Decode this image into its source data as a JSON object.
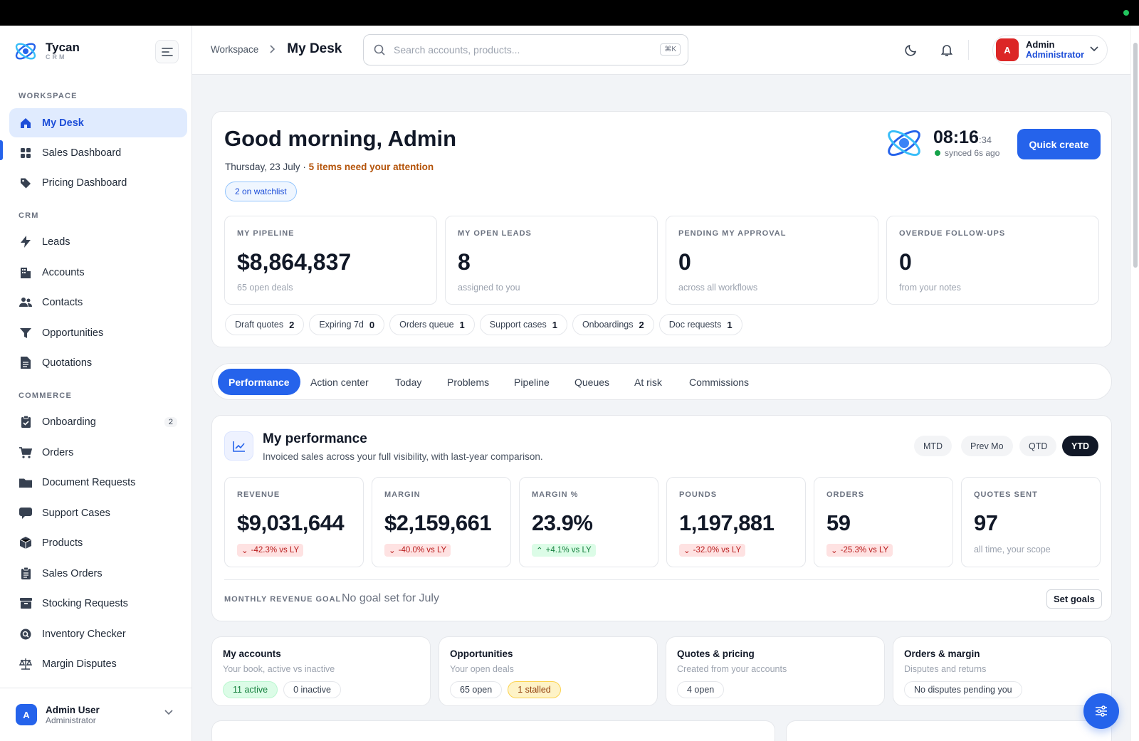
{
  "brand": {
    "name": "Tycan",
    "sub": "CRM"
  },
  "sidebar": {
    "sections": [
      "WORKSPACE",
      "CRM",
      "COMMERCE"
    ],
    "workspace": [
      {
        "label": "My Desk",
        "icon": "home-icon"
      },
      {
        "label": "Sales Dashboard",
        "icon": "grid-icon"
      },
      {
        "label": "Pricing Dashboard",
        "icon": "tag-icon"
      }
    ],
    "crm": [
      {
        "label": "Leads",
        "icon": "bolt-icon"
      },
      {
        "label": "Accounts",
        "icon": "building-icon"
      },
      {
        "label": "Contacts",
        "icon": "users-icon"
      },
      {
        "label": "Opportunities",
        "icon": "funnel-icon"
      },
      {
        "label": "Quotations",
        "icon": "document-icon"
      }
    ],
    "commerce": [
      {
        "label": "Onboarding",
        "icon": "clipboard-icon",
        "badge": "2"
      },
      {
        "label": "Orders",
        "icon": "cart-icon"
      },
      {
        "label": "Document Requests",
        "icon": "folder-icon"
      },
      {
        "label": "Support Cases",
        "icon": "chat-icon"
      },
      {
        "label": "Products",
        "icon": "cube-icon"
      },
      {
        "label": "Sales Orders",
        "icon": "receipt-icon"
      },
      {
        "label": "Stocking Requests",
        "icon": "archive-icon"
      },
      {
        "label": "Inventory Checker",
        "icon": "magnifier-icon"
      },
      {
        "label": "Margin Disputes",
        "icon": "scale-icon"
      }
    ],
    "user": {
      "initial": "A",
      "name": "Admin User",
      "role": "Administrator"
    }
  },
  "header": {
    "breadcrumb_root": "Workspace",
    "breadcrumb_current": "My Desk",
    "search_placeholder": "Search accounts, products...",
    "search_shortcut": "⌘K",
    "user": {
      "initial": "A",
      "name": "Admin",
      "role": "Administrator"
    }
  },
  "hero": {
    "greeting": "Good morning, Admin",
    "date": "Thursday, 23 July",
    "attention": "5 items need your attention",
    "watchlist": "2 on watchlist",
    "clock_time": "08:16",
    "clock_seconds": ":34",
    "synced": "synced 6s ago",
    "quick_create": "Quick create",
    "kpis": [
      {
        "label": "MY PIPELINE",
        "value": "$8,864,837",
        "hint": "65 open deals"
      },
      {
        "label": "MY OPEN LEADS",
        "value": "8",
        "hint": "assigned to you"
      },
      {
        "label": "PENDING MY APPROVAL",
        "value": "0",
        "hint": "across all workflows"
      },
      {
        "label": "OVERDUE FOLLOW-UPS",
        "value": "0",
        "hint": "from your notes"
      }
    ],
    "chips": [
      {
        "label": "Draft quotes",
        "count": "2"
      },
      {
        "label": "Expiring 7d",
        "count": "0"
      },
      {
        "label": "Orders queue",
        "count": "1"
      },
      {
        "label": "Support cases",
        "count": "1"
      },
      {
        "label": "Onboardings",
        "count": "2"
      },
      {
        "label": "Doc requests",
        "count": "1"
      }
    ]
  },
  "tabs": [
    "Performance",
    "Action center",
    "Today",
    "Problems",
    "Pipeline",
    "Queues",
    "At risk",
    "Commissions"
  ],
  "performance": {
    "title": "My performance",
    "subtitle": "Invoiced sales across your full visibility, with last-year comparison.",
    "ranges": [
      "MTD",
      "Prev Mo",
      "QTD",
      "YTD"
    ],
    "active_range": "YTD",
    "metrics": [
      {
        "label": "REVENUE",
        "value": "$9,031,644",
        "delta": "-42.3% vs LY",
        "dir": "down"
      },
      {
        "label": "MARGIN",
        "value": "$2,159,661",
        "delta": "-40.0% vs LY",
        "dir": "down"
      },
      {
        "label": "MARGIN %",
        "value": "23.9%",
        "delta": "+4.1% vs LY",
        "dir": "up"
      },
      {
        "label": "POUNDS",
        "value": "1,197,881",
        "delta": "-32.0% vs LY",
        "dir": "down"
      },
      {
        "label": "ORDERS",
        "value": "59",
        "delta": "-25.3% vs LY",
        "dir": "down"
      },
      {
        "label": "QUOTES SENT",
        "value": "97",
        "hint": "all time, your scope"
      }
    ],
    "goal_label": "MONTHLY REVENUE GOAL",
    "goal_text": "No goal set for July",
    "goal_button": "Set goals"
  },
  "mini_cards": [
    {
      "title": "My accounts",
      "sub": "Your book, active vs inactive",
      "pills": [
        {
          "text": "11 active",
          "tone": "green"
        },
        {
          "text": "0 inactive",
          "tone": ""
        }
      ]
    },
    {
      "title": "Opportunities",
      "sub": "Your open deals",
      "pills": [
        {
          "text": "65 open",
          "tone": ""
        },
        {
          "text": "1 stalled",
          "tone": "amber"
        }
      ]
    },
    {
      "title": "Quotes & pricing",
      "sub": "Created from your accounts",
      "pills": [
        {
          "text": "4 open",
          "tone": ""
        }
      ]
    },
    {
      "title": "Orders & margin",
      "sub": "Disputes and returns",
      "pills": [
        {
          "text": "No disputes pending you",
          "tone": ""
        }
      ]
    }
  ]
}
